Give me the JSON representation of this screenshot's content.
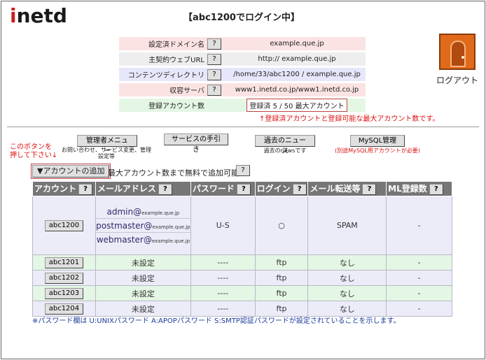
{
  "header": {
    "logo_first": "i",
    "logo_rest": "netd",
    "title": "【abc1200でログイン中】"
  },
  "info": {
    "domain_label": "設定済ドメイン名",
    "domain_value": "example.que.jp",
    "url_label": "主契約ウェブURL",
    "url_value": "http:// example.que.jp",
    "dir_label": "コンテンツディレクトリ",
    "dir_value": "/home/33/abc1200 / example.que.jp",
    "server_label": "収容サーバ",
    "server_value": "www1.inetd.co.jp/www1.inetd.co.jp",
    "accounts_label": "登録アカウント数",
    "accounts_value": "登録済 5 / 50 最大アカウント",
    "help_label": "?"
  },
  "note_red": "↑登録済アカウントと登録可能な最大アカウント数です。",
  "logout": {
    "label": "ログアウト",
    "icon": "door-icon"
  },
  "nav": {
    "admin_menu": "管理者メニュー",
    "admin_sub": "お問い合わせ、サービス変更、管理設定等",
    "service_guide": "サービスの手引き",
    "past_news": "過去のニュース",
    "past_news_sub": "過去のnewsです",
    "mysql": "MySQL管理",
    "mysql_sub": "(別途MySQL用アカウントが必要)"
  },
  "side_note": {
    "line1": "このボタンを",
    "line2": "押して下さい↓"
  },
  "add_account": {
    "button": "▼アカウントの追加",
    "note": "最大アカウント数まで無料で追加可能"
  },
  "table": {
    "headers": [
      "アカウント",
      "メールアドレス",
      "パスワード",
      "ログイン",
      "メール転送等",
      "ML登録数"
    ],
    "first_row": {
      "account": "abc1200",
      "mails": [
        {
          "user": "admin@",
          "domain": "example.que.jp"
        },
        {
          "user": "postmaster@",
          "domain": "example.que.jp"
        },
        {
          "user": "webmaster@",
          "domain": "example.que.jp"
        }
      ],
      "password": "U-S",
      "login": "○",
      "forward": "SPAM",
      "ml": "-"
    },
    "rows": [
      {
        "account": "abc1201",
        "mail": "未設定",
        "password": "----",
        "login": "ftp",
        "forward": "なし",
        "ml": "-"
      },
      {
        "account": "abc1202",
        "mail": "未設定",
        "password": "----",
        "login": "ftp",
        "forward": "なし",
        "ml": "-"
      },
      {
        "account": "abc1203",
        "mail": "未設定",
        "password": "----",
        "login": "ftp",
        "forward": "なし",
        "ml": "-"
      },
      {
        "account": "abc1204",
        "mail": "未設定",
        "password": "----",
        "login": "ftp",
        "forward": "なし",
        "ml": "-"
      }
    ]
  },
  "footnote": "※パスワード欄は U:UNIXパスワード A:APOPパスワード S:SMTP認証パスワードが設定されていることを示します。"
}
